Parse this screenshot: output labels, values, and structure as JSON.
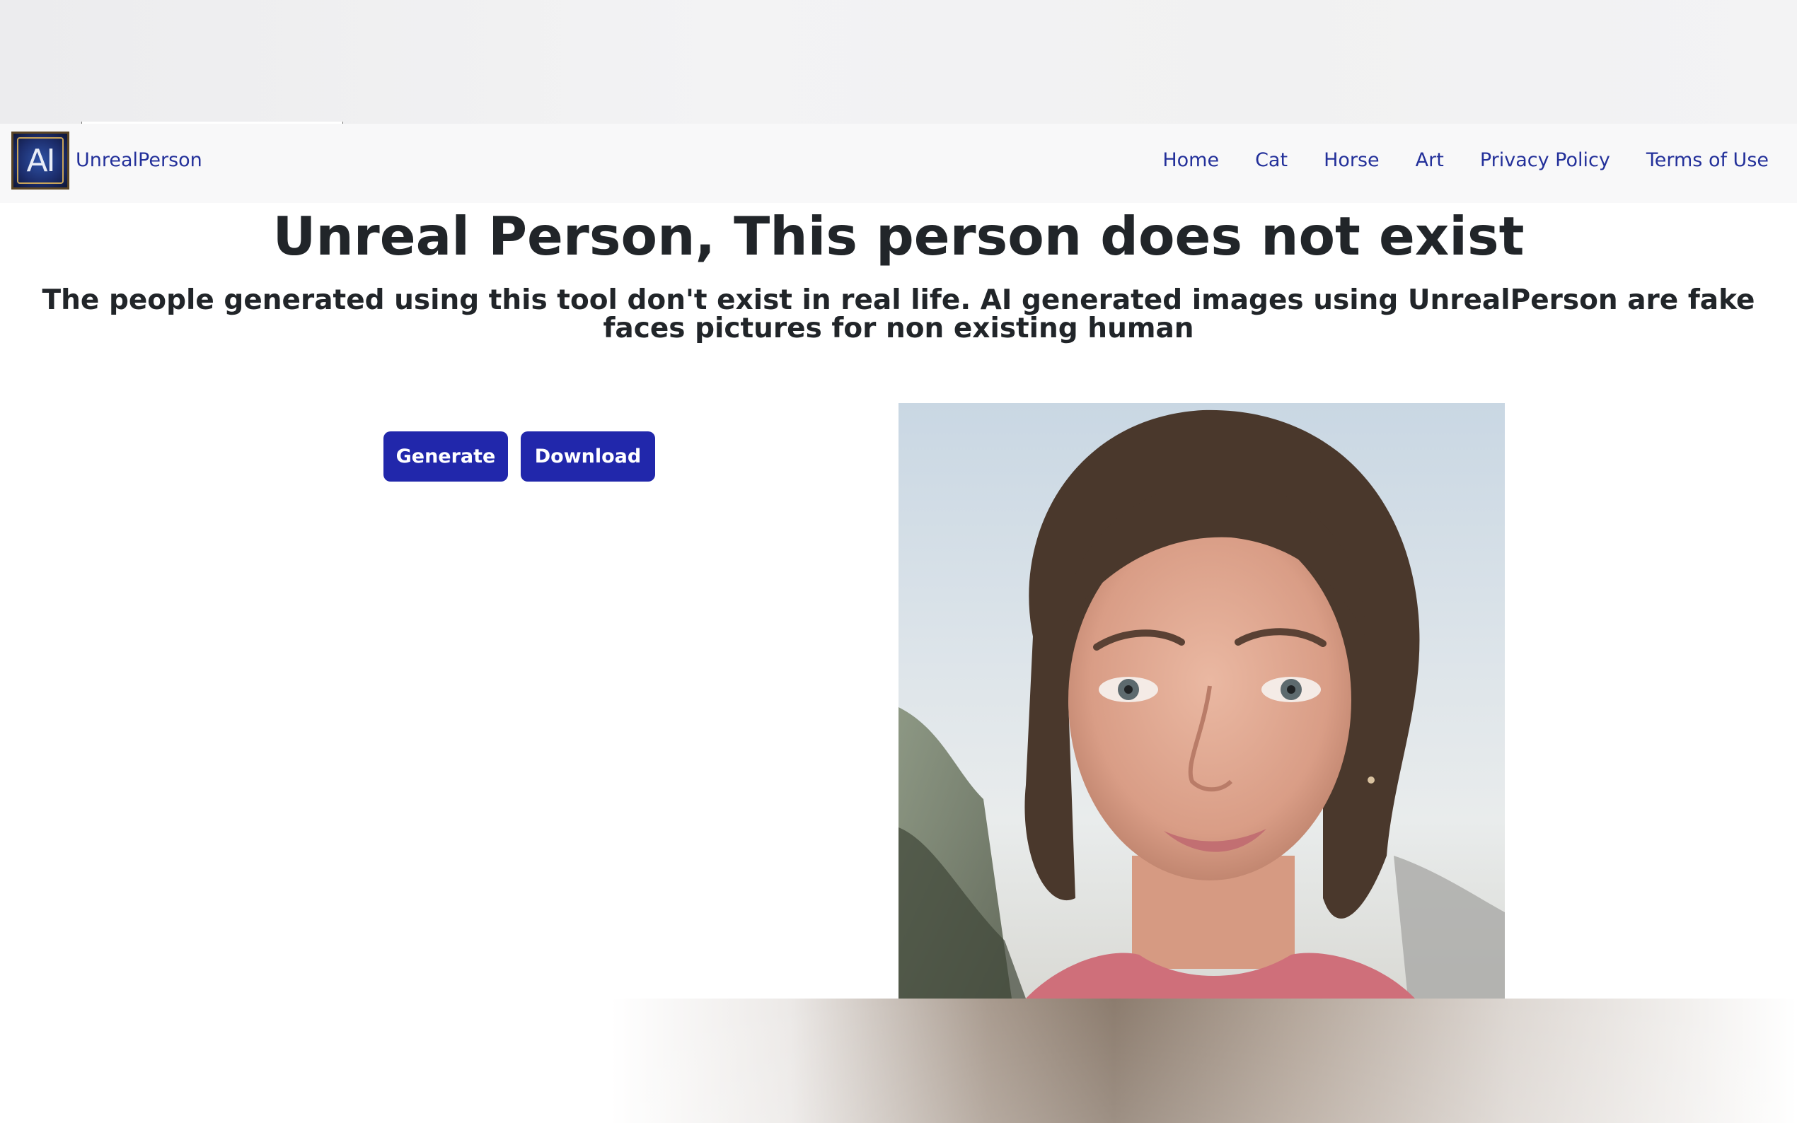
{
  "navbar": {
    "brand": "UnrealPerson",
    "logo_text": "AI",
    "links": [
      "Home",
      "Cat",
      "Horse",
      "Art",
      "Privacy Policy",
      "Terms of Use"
    ]
  },
  "main": {
    "title": "Unreal Person, This person does not exist",
    "subtitle": "The people generated using this tool don't exist in real life. AI generated images using UnrealPerson are fake faces pictures for non existing human",
    "generate_label": "Generate",
    "download_label": "Download"
  },
  "colors": {
    "accent": "#2127ab",
    "link": "#23309a",
    "heading": "#212529",
    "navbar_bg": "#f8f8f9"
  }
}
